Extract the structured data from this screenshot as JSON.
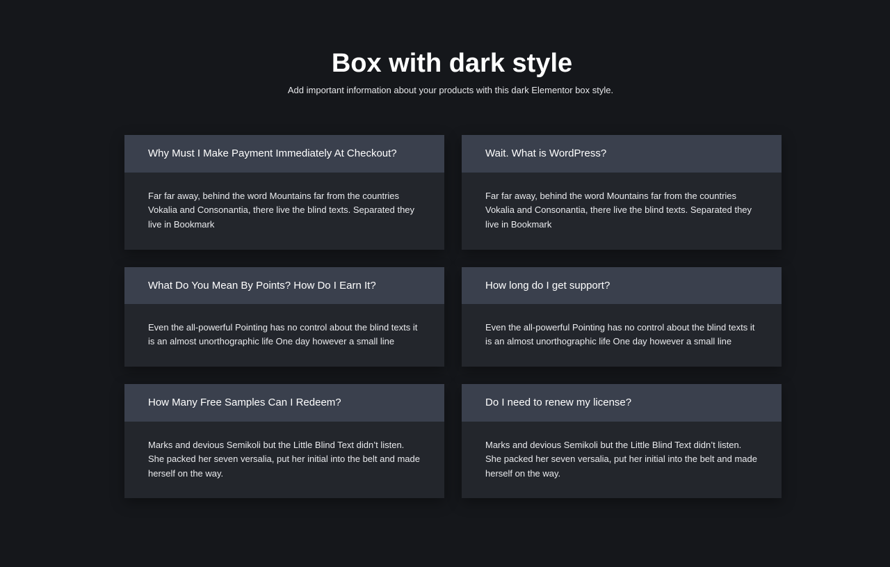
{
  "header": {
    "title": "Box with dark style",
    "subtitle": "Add important information about your products with this dark Elementor box style."
  },
  "boxes": [
    {
      "question": "Why Must I Make Payment Immediately At Checkout?",
      "answer": "Far far away, behind the word Mountains far from the countries Vokalia and Consonantia, there live the blind texts. Separated they live in Bookmark"
    },
    {
      "question": "Wait. What is WordPress?",
      "answer": "Far far away, behind the word Mountains far from the countries Vokalia and Consonantia, there live the blind texts. Separated they live in Bookmark"
    },
    {
      "question": "What Do You Mean By Points? How Do I Earn It?",
      "answer": "Even the all-powerful Pointing has no control about the blind texts it is an almost unorthographic life One day however a small line"
    },
    {
      "question": "How long do I get support?",
      "answer": "Even the all-powerful Pointing has no control about the blind texts it is an almost unorthographic life One day however a small line"
    },
    {
      "question": "How Many Free Samples Can I Redeem?",
      "answer": "Marks and devious Semikoli but the Little Blind Text didn’t listen. She packed her seven versalia, put her initial into the belt and made herself on the way."
    },
    {
      "question": "Do I need to renew my license?",
      "answer": "Marks and devious Semikoli but the Little Blind Text didn’t listen. She packed her seven versalia, put her initial into the belt and made herself on the way."
    }
  ],
  "colors": {
    "page_background": "#15171b",
    "box_header": "#3a404d",
    "box_body": "#23262c",
    "text": "#ffffff"
  }
}
